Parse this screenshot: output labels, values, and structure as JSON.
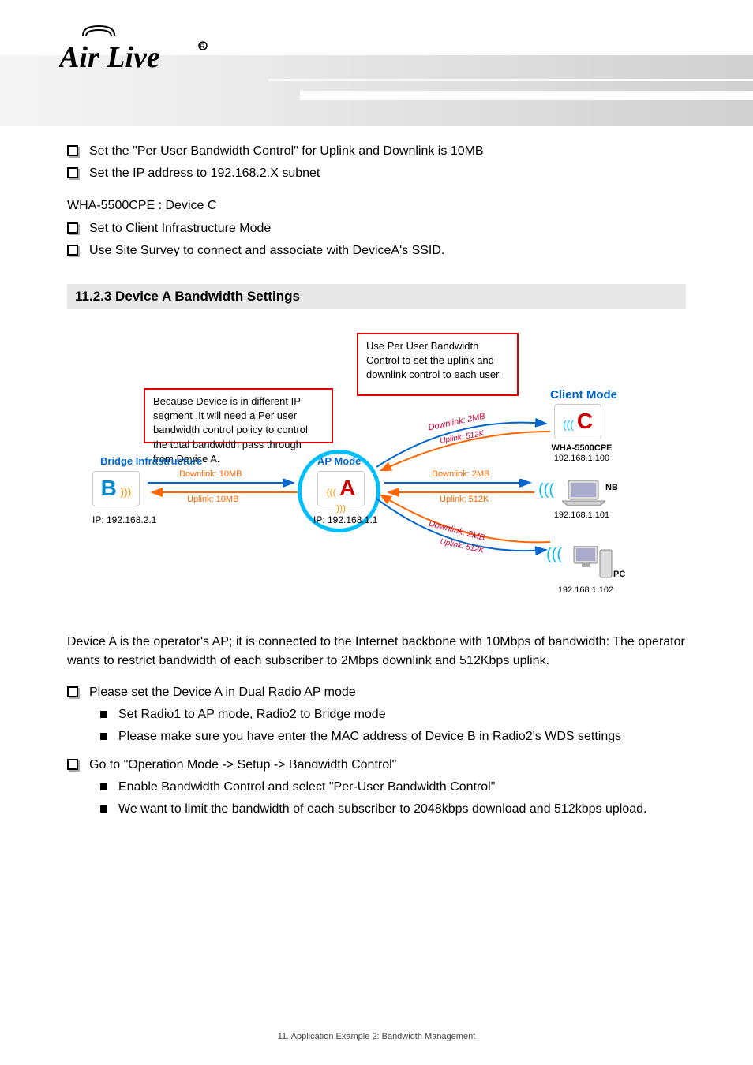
{
  "logo_text": "Air Live",
  "bullets_top": [
    "Set the \"Per User Bandwidth Control\" for Uplink and Downlink is 10MB",
    "Set the IP address to 192.168.2.X subnet"
  ],
  "device_c_heading": "WHA-5500CPE : Device C",
  "bullets_c": [
    "Set to Client Infrastructure Mode",
    "Use Site Survey to connect and associate with DeviceA's SSID."
  ],
  "section_title": "11.2.3 Device A Bandwidth Settings",
  "red_box_left": "Because Device is in different IP segment .It will need a Per user bandwidth control policy to control the total bandwidth pass through from Device A.",
  "red_box_right": "Use Per User Bandwidth Control to set the uplink and downlink control to each user.",
  "diagram": {
    "client_mode": "Client Mode",
    "bridge_inf": "Bridge Infrastructure",
    "ap_mode": "AP Mode",
    "node_a": "A",
    "node_b": "B",
    "node_c": "C",
    "ip_a": "IP: 192.168.1.1",
    "ip_b": "IP: 192.168.2.1",
    "wha_label": "WHA-5500CPE",
    "ip_c": "192.168.1.100",
    "nb_label": "NB",
    "ip_nb": "192.168.1.101",
    "pc_label": "PC",
    "ip_pc": "192.168.1.102",
    "downlink_10": "Downlink: 10MB",
    "uplink_10": "Uplink: 10MB",
    "downlink_2": "Downlink: 2MB",
    "uplink_512": "Uplink: 512K"
  },
  "device_a_intro": "Device A is the operator's AP; it is connected to the Internet backbone with 10Mbps of bandwidth: The operator wants to restrict bandwidth of each subscriber to 2Mbps downlink and 512Kbps uplink.",
  "bullets_a": [
    {
      "main": "Please set the Device A in Dual Radio AP mode",
      "subs": [
        "Set Radio1 to AP mode, Radio2 to Bridge mode",
        "Please make sure you have enter the MAC address of Device B in Radio2's WDS settings"
      ]
    },
    {
      "main": "Go to \"Operation Mode -> Setup -> Bandwidth Control\"",
      "subs": [
        "Enable Bandwidth Control and select \"Per-User Bandwidth Control\"",
        "We want to limit the bandwidth of each subscriber to 2048kbps download and 512kbps upload."
      ]
    }
  ],
  "footer": "11. Application Example 2: Bandwidth Management"
}
